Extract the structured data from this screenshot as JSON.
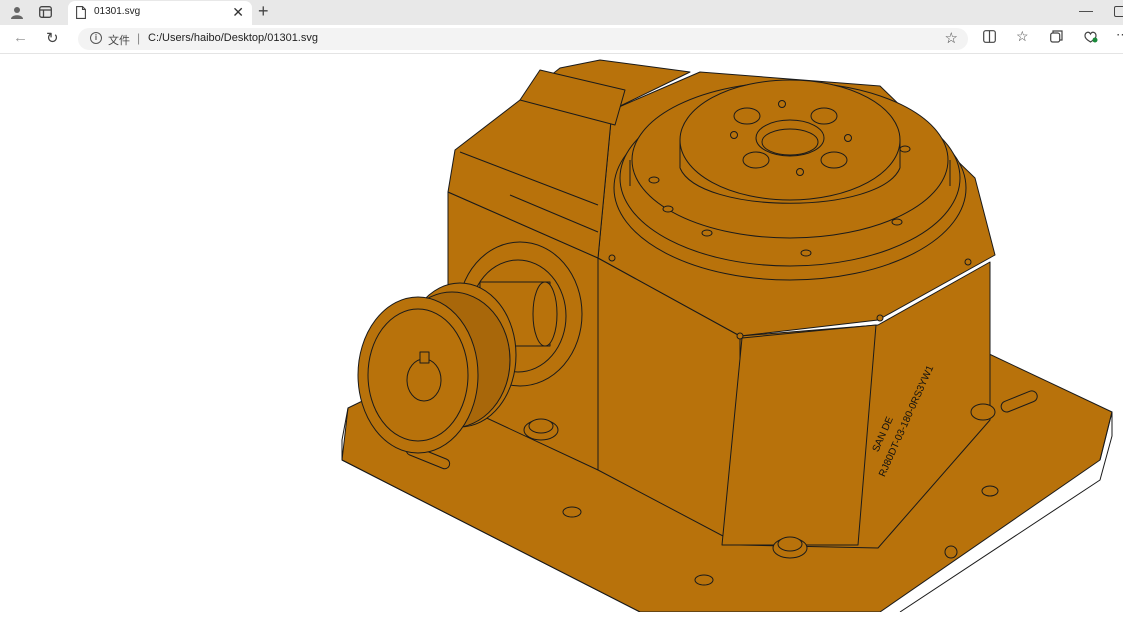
{
  "browser": {
    "tab": {
      "title": "01301.svg"
    },
    "address": {
      "scheme": "文件",
      "separator": "|",
      "url": "C:/Users/haibo/Desktop/01301.svg"
    }
  },
  "drawing": {
    "part_color": "#b8720b",
    "line_color": "#1a1a1a",
    "label_line1": "SAN DE",
    "label_line2": "RJ80DT-03-180-0RS3YW1"
  },
  "icons": [
    "profile-icon",
    "tab-actions-icon",
    "file-icon",
    "close-icon",
    "plus-icon",
    "back-icon",
    "reload-icon",
    "info-icon",
    "star-icon",
    "split-screen-icon",
    "favorites-icon",
    "collections-icon",
    "copilot-icon",
    "more-icon",
    "minimize-icon",
    "maximize-icon"
  ]
}
